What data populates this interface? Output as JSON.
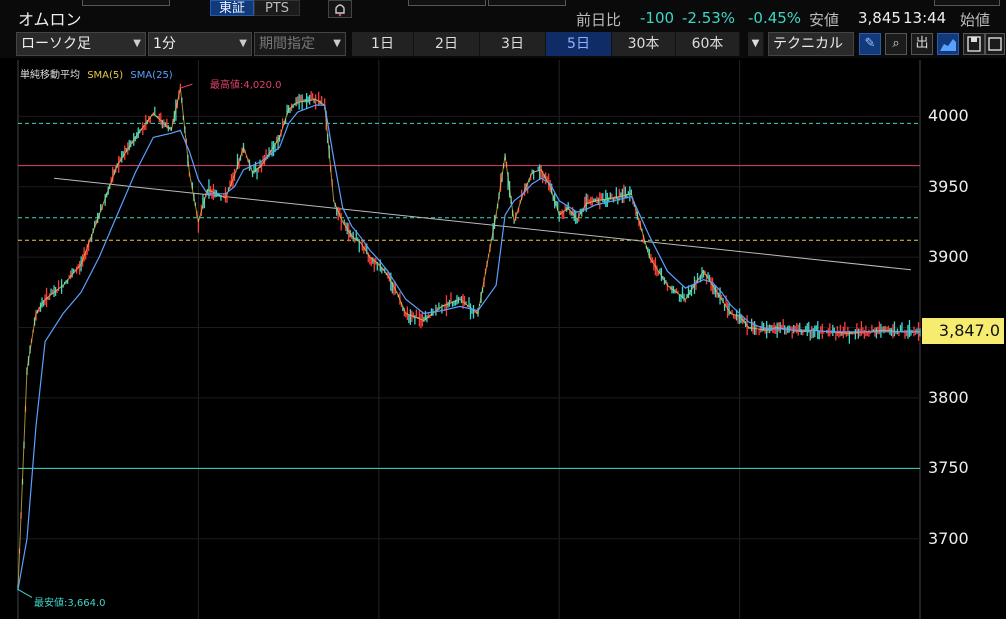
{
  "header": {
    "title": "オムロン",
    "tab_tse": "東証",
    "tab_pts": "PTS",
    "prev_label": "前日比",
    "change": "-100",
    "change_pct": "-2.53%",
    "change_pct2": "-0.45%",
    "low_label": "安値",
    "low_value": "3,845",
    "time": "13:44",
    "open_label": "始値"
  },
  "toolbar": {
    "chart_type": "ローソク足",
    "interval": "1分",
    "period_select": "期間指定",
    "ranges": [
      "1日",
      "2日",
      "3日",
      "5日",
      "30本",
      "60本"
    ],
    "active_range": "5日",
    "technical": "テクニカル"
  },
  "legend": {
    "title": "単純移動平均",
    "sma5": "SMA(5)",
    "sma25": "SMA(25)"
  },
  "annotations": {
    "high": "最高値:4,020.0",
    "low": "最安値:3,664.0"
  },
  "current_price": "3,847.0",
  "colors": {
    "up": "#ff3b3b",
    "down": "#3ed6c8",
    "sma5": "#e6c84a",
    "sma25": "#5aa0ff",
    "resistance": "#e0406a",
    "price_tag": "#f6ec70"
  },
  "chart_data": {
    "type": "line",
    "y_ticks": [
      3700,
      3750,
      3800,
      3850,
      3900,
      3950,
      4000
    ],
    "y_tick_labels": [
      "3700",
      "3750",
      "3800",
      "",
      "3900",
      "3950",
      "4000"
    ],
    "ylim": [
      3643,
      4040
    ],
    "xlim": [
      0,
      100
    ],
    "price_x": [
      0,
      1,
      2,
      3,
      5,
      7,
      9,
      11,
      13,
      15,
      17,
      18,
      19,
      20,
      21,
      23,
      24,
      25,
      26,
      27,
      29,
      30,
      31,
      33,
      34,
      35,
      36,
      37,
      38,
      39,
      40,
      41,
      42,
      43,
      45,
      47,
      49,
      51,
      53,
      54,
      55,
      56,
      57,
      58,
      59,
      60,
      61,
      62,
      63,
      64,
      66,
      68,
      70,
      72,
      74,
      76,
      77,
      78,
      79,
      80,
      81,
      82,
      83,
      84,
      85,
      86,
      87,
      88,
      90,
      92,
      94,
      96,
      98,
      100
    ],
    "price_y": [
      3664,
      3820,
      3860,
      3870,
      3880,
      3895,
      3930,
      3965,
      3985,
      4002,
      3990,
      4020,
      3960,
      3925,
      3948,
      3942,
      3958,
      3978,
      3960,
      3965,
      3985,
      4005,
      4010,
      4012,
      4008,
      3940,
      3925,
      3915,
      3910,
      3900,
      3895,
      3887,
      3875,
      3860,
      3855,
      3865,
      3870,
      3860,
      3930,
      3972,
      3925,
      3945,
      3960,
      3962,
      3950,
      3930,
      3935,
      3927,
      3938,
      3940,
      3942,
      3945,
      3900,
      3880,
      3870,
      3890,
      3880,
      3870,
      3860,
      3858,
      3850,
      3849,
      3848,
      3850,
      3849,
      3848,
      3847,
      3848,
      3847,
      3846,
      3847,
      3848,
      3847,
      3847
    ],
    "sma25_y": [
      3664,
      3700,
      3780,
      3840,
      3860,
      3875,
      3900,
      3930,
      3960,
      3985,
      3988,
      3990,
      3975,
      3955,
      3945,
      3945,
      3950,
      3962,
      3965,
      3968,
      3978,
      3995,
      4003,
      4008,
      4008,
      3970,
      3935,
      3922,
      3914,
      3905,
      3898,
      3890,
      3880,
      3870,
      3860,
      3862,
      3865,
      3862,
      3880,
      3930,
      3940,
      3945,
      3952,
      3956,
      3952,
      3940,
      3936,
      3932,
      3934,
      3937,
      3940,
      3943,
      3915,
      3890,
      3878,
      3884,
      3882,
      3875,
      3866,
      3860,
      3854,
      3851,
      3849,
      3849,
      3849,
      3848,
      3848,
      3848,
      3847,
      3847,
      3847,
      3847,
      3847,
      3847
    ],
    "h_lines": [
      {
        "y": 3995,
        "color": "#3ed6c8",
        "style": "dashed"
      },
      {
        "y": 3965,
        "color": "#e0406a",
        "style": "solid"
      },
      {
        "y": 3928,
        "color": "#3ed6c8",
        "style": "dashed"
      },
      {
        "y": 3912,
        "color": "#e6c84a",
        "style": "dashed"
      },
      {
        "y": 3750,
        "color": "#3ed6c8",
        "style": "solid"
      }
    ],
    "trend_line": {
      "x": [
        4,
        99
      ],
      "y": [
        3956,
        3891
      ]
    },
    "grid": true,
    "vertical_separators": [
      20,
      40,
      60,
      80
    ]
  }
}
